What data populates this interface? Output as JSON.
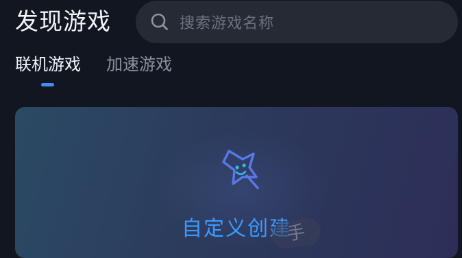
{
  "header": {
    "title": "发现游戏"
  },
  "search": {
    "placeholder": "搜索游戏名称",
    "icon": "search-icon"
  },
  "tabs": [
    {
      "label": "联机游戏",
      "active": true
    },
    {
      "label": "加速游戏",
      "active": false
    }
  ],
  "create_card": {
    "label": "自定义创建",
    "icon": "star-wand-icon"
  },
  "watermark": {
    "text": "手"
  },
  "colors": {
    "background": "#121620",
    "search_bg": "#262A34",
    "accent": "#3D8FF5",
    "card_label": "#3A9BFF",
    "star_stroke": "#5A78E8",
    "star_face": "#34B6E6"
  }
}
